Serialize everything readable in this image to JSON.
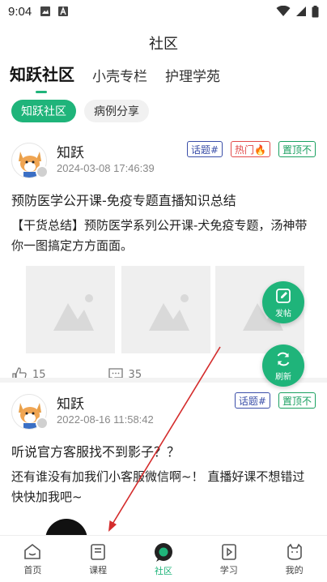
{
  "status_bar": {
    "time": "9:04"
  },
  "page": {
    "title": "社区"
  },
  "main_tabs": [
    {
      "label": "知跃社区",
      "active": true
    },
    {
      "label": "小壳专栏",
      "active": false
    },
    {
      "label": "护理学苑",
      "active": false
    }
  ],
  "sub_tabs": [
    {
      "label": "知跃社区",
      "active": true
    },
    {
      "label": "病例分享",
      "active": false
    }
  ],
  "posts": [
    {
      "author": "知跃",
      "time": "2024-03-08 17:46:39",
      "tags": [
        "话题#",
        "热门🔥",
        "置顶不"
      ],
      "title": "预防医学公开课-免疫专题直播知识总结",
      "body": "【干货总结】预防医学系列公开课-犬免疫专题，汤神带你一图搞定方方面面。",
      "likes": "15",
      "comments": "35"
    },
    {
      "author": "知跃",
      "time": "2022-08-16 11:58:42",
      "tags": [
        "话题#",
        "置顶不"
      ],
      "title": "听说官方客服找不到影子？？",
      "body": "还有谁没有加我们小客服微信啊~！ 直播好课不想错过快快加我吧~"
    }
  ],
  "fabs": {
    "post": "发帖",
    "refresh": "刷新"
  },
  "bottom_nav": [
    {
      "label": "首页",
      "active": false
    },
    {
      "label": "课程",
      "active": false
    },
    {
      "label": "社区",
      "active": true
    },
    {
      "label": "学习",
      "active": false
    },
    {
      "label": "我的",
      "active": false
    }
  ],
  "colors": {
    "accent": "#1fb47a",
    "tag_topic": "#3a4ea8",
    "tag_hot": "#e24a4a",
    "annotation": "#d42c2c"
  }
}
